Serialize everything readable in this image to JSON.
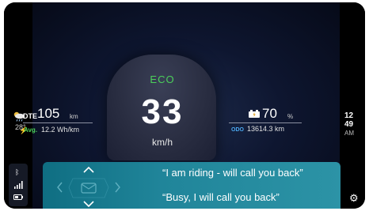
{
  "dashboard": {
    "mode": "ECO",
    "speed": "33",
    "speed_unit": "km/h",
    "dte_label": "DTE",
    "dte_value": "105",
    "dte_unit": "km",
    "avg_label": "Avg.",
    "avg_value": "12.2 Wh/km",
    "battery_value": "70",
    "battery_unit": "%",
    "odo_label": "ODO",
    "odo_value": "13614.3 km",
    "temperature": "28°",
    "clock_hour": "12",
    "clock_minute": "49",
    "clock_ampm": "AM"
  },
  "quick_replies": [
    {
      "label": "“I am riding - will call you back”"
    },
    {
      "label": "“Busy, I will call you back”"
    }
  ],
  "icons": {
    "weather": "partly-cloudy-rain-icon",
    "bluetooth": "bluetooth-icon",
    "signal": "signal-icon",
    "phone_battery": "battery-icon",
    "settings": "gear-icon",
    "battery": "battery-charge-icon"
  },
  "colors": {
    "eco": "#4bd05a",
    "odo": "#4ba8f0",
    "reply_panel": "#20859a"
  }
}
